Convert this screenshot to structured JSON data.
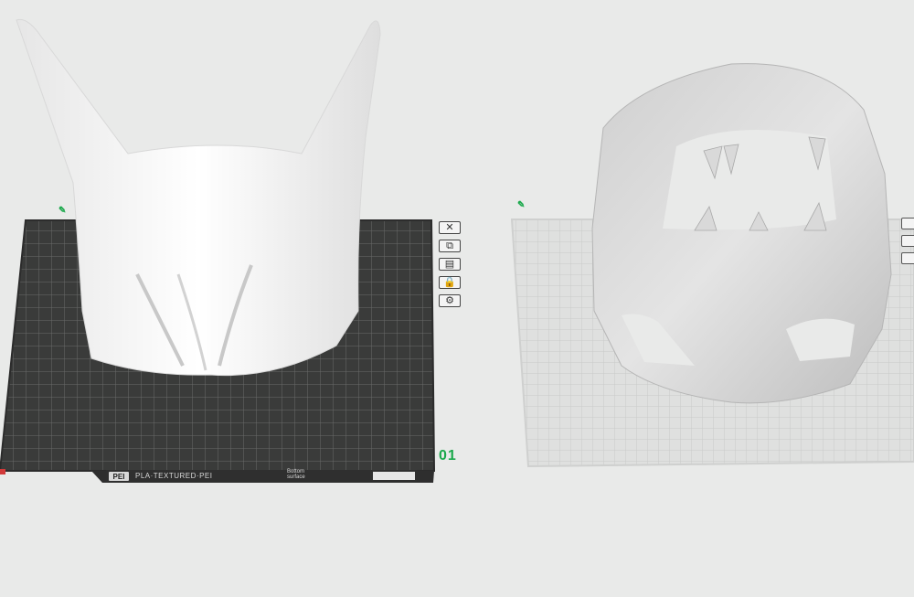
{
  "plates": [
    {
      "number": "01",
      "name": "PLA·TEXTURED·PEI",
      "surface_label": "Bottom surface",
      "type_badge": "PEI",
      "edit_icon": "pencil-icon"
    },
    {
      "edit_icon": "pencil-icon"
    }
  ],
  "plate_tools": [
    {
      "icon": "close-icon",
      "glyph": "✕"
    },
    {
      "icon": "auto-orient-icon",
      "glyph": "⧉"
    },
    {
      "icon": "arrange-icon",
      "glyph": "▤"
    },
    {
      "icon": "lock-icon",
      "glyph": "🔒"
    },
    {
      "icon": "settings-icon",
      "glyph": "⚙"
    }
  ],
  "colors": {
    "background": "#e9eae9",
    "plate_dark": "#3d3d3d",
    "plate_light": "#e2e3e2",
    "accent": "#1aa84b"
  }
}
